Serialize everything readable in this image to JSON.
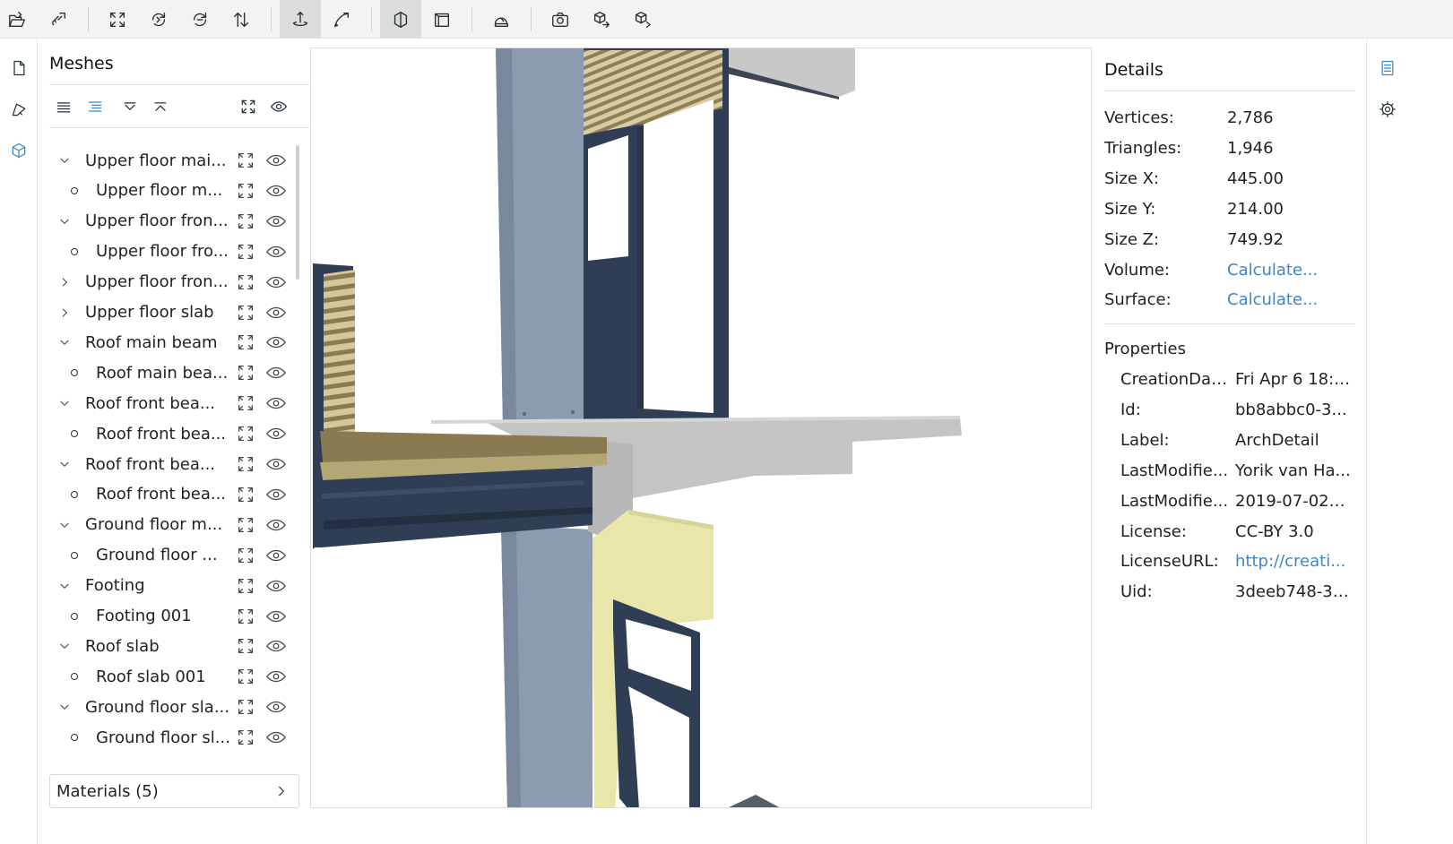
{
  "toolbar": {
    "buttons": [
      {
        "name": "open-file-icon"
      },
      {
        "name": "open-url-icon"
      },
      {
        "name": "fit-to-window-icon"
      },
      {
        "name": "set-up-vector-icon"
      },
      {
        "name": "flip-up-vector-icon"
      },
      {
        "name": "fix-up-vector-icon"
      },
      {
        "name": "turntable-navigation-icon",
        "active": true
      },
      {
        "name": "free-navigation-icon"
      },
      {
        "name": "perspective-camera-icon",
        "active": true
      },
      {
        "name": "orthographic-camera-icon"
      },
      {
        "name": "measure-icon"
      },
      {
        "name": "snapshot-icon"
      },
      {
        "name": "export-icon"
      },
      {
        "name": "share-icon"
      }
    ]
  },
  "left_nav": [
    {
      "name": "files-icon"
    },
    {
      "name": "measurement-icon"
    },
    {
      "name": "meshes-icon",
      "selected": true
    }
  ],
  "meshes_panel": {
    "title": "Meshes",
    "tree": [
      {
        "label": "Upper floor mai...",
        "level": 0,
        "state": "expanded"
      },
      {
        "label": "Upper floor m...",
        "level": 1
      },
      {
        "label": "Upper floor fron...",
        "level": 0,
        "state": "expanded"
      },
      {
        "label": "Upper floor fro...",
        "level": 1
      },
      {
        "label": "Upper floor fron...",
        "level": 0,
        "state": "collapsed"
      },
      {
        "label": "Upper floor slab",
        "level": 0,
        "state": "collapsed"
      },
      {
        "label": "Roof main beam",
        "level": 0,
        "state": "expanded"
      },
      {
        "label": "Roof main bea...",
        "level": 1
      },
      {
        "label": "Roof front bea...",
        "level": 0,
        "state": "expanded"
      },
      {
        "label": "Roof front bea...",
        "level": 1
      },
      {
        "label": "Roof front bea...",
        "level": 0,
        "state": "expanded"
      },
      {
        "label": "Roof front bea...",
        "level": 1
      },
      {
        "label": "Ground floor m...",
        "level": 0,
        "state": "expanded"
      },
      {
        "label": "Ground floor ...",
        "level": 1
      },
      {
        "label": "Footing",
        "level": 0,
        "state": "expanded"
      },
      {
        "label": "Footing 001",
        "level": 1
      },
      {
        "label": "Roof slab",
        "level": 0,
        "state": "expanded"
      },
      {
        "label": "Roof slab 001",
        "level": 1
      },
      {
        "label": "Ground floor sla...",
        "level": 0,
        "state": "expanded"
      },
      {
        "label": "Ground floor sl...",
        "level": 1
      }
    ],
    "materials_label": "Materials (5)"
  },
  "details_panel": {
    "title": "Details",
    "stats": [
      {
        "key": "Vertices:",
        "value": "2,786"
      },
      {
        "key": "Triangles:",
        "value": "1,946"
      },
      {
        "key": "Size X:",
        "value": "445.00"
      },
      {
        "key": "Size Y:",
        "value": "214.00"
      },
      {
        "key": "Size Z:",
        "value": "749.92"
      },
      {
        "key": "Volume:",
        "value": "Calculate...",
        "link": true
      },
      {
        "key": "Surface:",
        "value": "Calculate...",
        "link": true
      }
    ],
    "properties_title": "Properties",
    "properties": [
      {
        "key": "CreationDate:",
        "value": "Fri Apr 6 18:4..."
      },
      {
        "key": "Id:",
        "value": "bb8abbc0-3..."
      },
      {
        "key": "Label:",
        "value": "ArchDetail"
      },
      {
        "key": "LastModifie...",
        "value": "Yorik van Ha..."
      },
      {
        "key": "LastModifie...",
        "value": "2019-07-02T1..."
      },
      {
        "key": "License:",
        "value": "CC-BY 3.0"
      },
      {
        "key": "LicenseURL:",
        "value": "http://creati...",
        "link": true
      },
      {
        "key": "Uid:",
        "value": "3deeb748-31..."
      }
    ]
  },
  "right_nav": [
    {
      "name": "details-icon",
      "selected": true
    },
    {
      "name": "settings-icon"
    }
  ],
  "colors": {
    "accent": "#3a86c8",
    "steel": "#2e3d52",
    "column": "#8a99ad",
    "concrete": "#c4c4c4",
    "wood": "#8c7c55",
    "insulation": "#e7e5a8"
  }
}
